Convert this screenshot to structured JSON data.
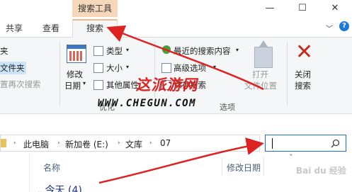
{
  "contextual_tab_group": "搜索工具",
  "window_controls": {
    "minimize": "—",
    "maximize": "☐",
    "close": "✕"
  },
  "tabs": {
    "share": "共享",
    "view": "查看",
    "search": "搜索"
  },
  "ribbon_toggle": "﹀",
  "help": "?",
  "ribbon": {
    "partial_items": [
      "夹",
      "文件夹",
      "置再次搜索"
    ],
    "date_modified": [
      "修改",
      "日期"
    ],
    "type": "类型",
    "size": "大小",
    "other_props": "其他属性",
    "recent_searches": "最近的搜索内容",
    "advanced_options": "高级选项",
    "save_search": "保存搜索",
    "open_location": [
      "打开",
      "文件位置"
    ],
    "close_search": [
      "关闭",
      "搜索"
    ],
    "group_options": "选项",
    "group_truncated": "优化"
  },
  "watermark": {
    "title": "这派游网",
    "url": "WWW.CHEGUN.COM"
  },
  "address_bar": {
    "crumbs": [
      "此电脑",
      "新加卷 (E:)",
      "文库",
      "07"
    ],
    "refresh_icon": "↻"
  },
  "search_box": {
    "value": ""
  },
  "file_list": {
    "col_name": "名称",
    "col_modified": "修改日期",
    "group_today": "今天 (4)",
    "sort_indicator": "ˇ"
  },
  "brand_watermark": "Bai du 经验",
  "accent_color": "#1d6fcc",
  "arrow_color": "#d22"
}
